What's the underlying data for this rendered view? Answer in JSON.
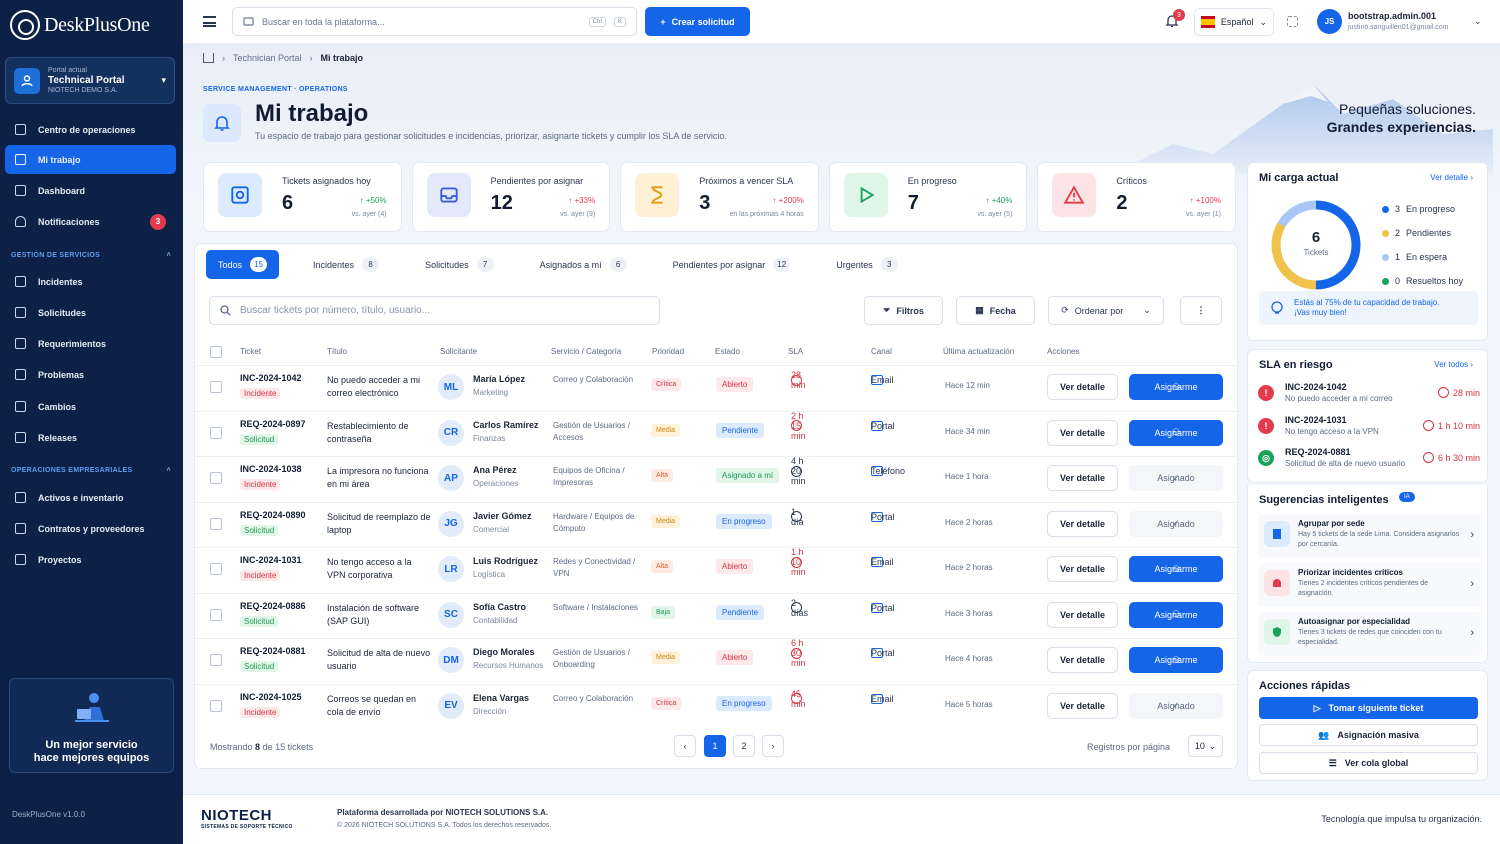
{
  "app": {
    "logo_text": "DeskPlusOne",
    "version": "DeskPlusOne v1.0.0"
  },
  "portal": {
    "caption": "Portal actual",
    "name": "Technical Portal",
    "org": "NIOTECH DEMO S.A."
  },
  "nav": {
    "main": [
      {
        "label": "Centro de operaciones"
      },
      {
        "label": "Mi trabajo",
        "active": true
      },
      {
        "label": "Dashboard"
      },
      {
        "label": "Notificaciones",
        "badge": "3"
      }
    ],
    "section_services": "GESTIÓN DE SERVICIOS",
    "services": [
      {
        "label": "Incidentes"
      },
      {
        "label": "Solicitudes"
      },
      {
        "label": "Requerimientos"
      },
      {
        "label": "Problemas"
      },
      {
        "label": "Cambios"
      },
      {
        "label": "Releases"
      }
    ],
    "section_ops": "OPERACIONES EMPRESARIALES",
    "ops": [
      {
        "label": "Activos e inventario"
      },
      {
        "label": "Contratos y proveedores"
      },
      {
        "label": "Proyectos"
      }
    ]
  },
  "promo": {
    "line1": "Un mejor servicio",
    "line2": "hace mejores equipos"
  },
  "topbar": {
    "search_placeholder": "Buscar en toda la plataforma...",
    "kbd1": "Ctrl",
    "kbd2": "K",
    "create_label": "Crear solicitud",
    "notif_count": "3",
    "language": "Español",
    "avatar_initials": "JS",
    "user_name": "bootstrap.admin.001",
    "user_email": "justino.sanguillen01@gmail.com"
  },
  "breadcrumb": {
    "parent": "Technician Portal",
    "current": "Mi trabajo"
  },
  "page": {
    "eyebrow": "SERVICE MANAGEMENT · OPERATIONS",
    "title": "Mi trabajo",
    "subtitle": "Tu espacio de trabajo para gestionar solicitudes e incidencias, priorizar, asignarte tickets y cumplir los SLA de servicio.",
    "slogan1": "Pequeñas soluciones.",
    "slogan2": "Grandes experiencias."
  },
  "kpis": [
    {
      "label": "Tickets asignados hoy",
      "value": "6",
      "delta": "+50%",
      "note": "vs. ayer (4)",
      "trend": "up",
      "color": "#1565e8",
      "bg": "#dceafd",
      "icon": "ticket-icon"
    },
    {
      "label": "Pendientes por asignar",
      "value": "12",
      "delta": "+33%",
      "note": "vs. ayer (9)",
      "trend": "down",
      "color": "#3a5bd9",
      "bg": "#e4e8fb",
      "icon": "inbox-icon"
    },
    {
      "label": "Próximos a vencer SLA",
      "value": "3",
      "delta": "+200%",
      "note": "en las próximas 4 horas",
      "trend": "down",
      "color": "#e29a12",
      "bg": "#fff0d6",
      "icon": "hourglass-icon"
    },
    {
      "label": "En progreso",
      "value": "7",
      "delta": "+40%",
      "note": "vs. ayer (5)",
      "trend": "up",
      "color": "#1aa35a",
      "bg": "#dff5e8",
      "icon": "play-icon"
    },
    {
      "label": "Críticos",
      "value": "2",
      "delta": "+100%",
      "note": "vs. ayer (1)",
      "trend": "down",
      "color": "#e33b4b",
      "bg": "#fde3e6",
      "icon": "warning-icon"
    }
  ],
  "tabs": [
    {
      "label": "Todos",
      "count": "15",
      "active": true
    },
    {
      "label": "Incidentes",
      "count": "8"
    },
    {
      "label": "Solicitudes",
      "count": "7"
    },
    {
      "label": "Asignados a mí",
      "count": "6"
    },
    {
      "label": "Pendientes por asignar",
      "count": "12"
    },
    {
      "label": "Urgentes",
      "count": "3"
    }
  ],
  "table": {
    "search_placeholder": "Buscar tickets por número, título, usuario...",
    "filters_label": "Filtros",
    "date_label": "Fecha",
    "sort_label": "Ordenar por",
    "headers": [
      "Ticket",
      "Título",
      "Solicitante",
      "Servicio / Categoría",
      "Prioridad",
      "Estado",
      "SLA",
      "Canal",
      "Última actualización",
      "Acciones"
    ],
    "view_label": "Ver detalle",
    "rows": [
      {
        "id": "INC-2024-1042",
        "type": "Incidente",
        "kind": "inc",
        "title": "No puedo acceder a mi correo electrónico",
        "initials": "ML",
        "name": "María López",
        "dept": "Marketing",
        "service": "Correo y Colaboración",
        "priority": "Crítica",
        "pclass": "critica",
        "status": "Abierto",
        "sclass": "abierto",
        "sla": "28 min",
        "slaclass": "red",
        "channel": "Email",
        "updated": "Hace 12 min",
        "action": "Asignarme",
        "aclass": "primary"
      },
      {
        "id": "REQ-2024-0897",
        "type": "Solicitud",
        "kind": "sol",
        "title": "Restablecimiento de contraseña",
        "initials": "CR",
        "name": "Carlos Ramírez",
        "dept": "Finanzas",
        "service": "Gestión de Usuarios / Accesos",
        "priority": "Media",
        "pclass": "media",
        "status": "Pendiente",
        "sclass": "pendiente",
        "sla": "2 h 15 min",
        "slaclass": "red",
        "channel": "Portal",
        "updated": "Hace 34 min",
        "action": "Asignarme",
        "aclass": "primary"
      },
      {
        "id": "INC-2024-1038",
        "type": "Incidente",
        "kind": "inc",
        "title": "La impresora no funciona en mi área",
        "initials": "AP",
        "name": "Ana Pérez",
        "dept": "Operaciones",
        "service": "Equipos de Oficina / Impresoras",
        "priority": "Alta",
        "pclass": "alta",
        "status": "Asignado a mí",
        "sclass": "asignado",
        "sla": "4 h 20 min",
        "slaclass": "dark",
        "channel": "Teléfono",
        "updated": "Hace 1 hora",
        "action": "Asignado",
        "aclass": "ghost"
      },
      {
        "id": "REQ-2024-0890",
        "type": "Solicitud",
        "kind": "sol",
        "title": "Solicitud de reemplazo de laptop",
        "initials": "JG",
        "name": "Javier Gómez",
        "dept": "Comercial",
        "service": "Hardware / Equipos de Cómputo",
        "priority": "Media",
        "pclass": "media",
        "status": "En progreso",
        "sclass": "progreso",
        "sla": "1 día",
        "slaclass": "dark",
        "channel": "Portal",
        "updated": "Hace 2 horas",
        "action": "Asignado",
        "aclass": "ghost"
      },
      {
        "id": "INC-2024-1031",
        "type": "Incidente",
        "kind": "inc",
        "title": "No tengo acceso a la VPN corporativa",
        "initials": "LR",
        "name": "Luis Rodríguez",
        "dept": "Logística",
        "service": "Redes y Conectividad / VPN",
        "priority": "Alta",
        "pclass": "alta",
        "status": "Abierto",
        "sclass": "abierto",
        "sla": "1 h 10 min",
        "slaclass": "red",
        "channel": "Email",
        "updated": "Hace 2 horas",
        "action": "Asignarme",
        "aclass": "primary"
      },
      {
        "id": "REQ-2024-0886",
        "type": "Solicitud",
        "kind": "sol",
        "title": "Instalación de software (SAP GUI)",
        "initials": "SC",
        "name": "Sofía Castro",
        "dept": "Contabilidad",
        "service": "Software / Instalaciones",
        "priority": "Baja",
        "pclass": "baja",
        "status": "Pendiente",
        "sclass": "pendiente",
        "sla": "2 días",
        "slaclass": "dark",
        "channel": "Portal",
        "updated": "Hace 3 horas",
        "action": "Asignarme",
        "aclass": "primary"
      },
      {
        "id": "REQ-2024-0881",
        "type": "Solicitud",
        "kind": "sol",
        "title": "Solicitud de alta de nuevo usuario",
        "initials": "DM",
        "name": "Diego Morales",
        "dept": "Recursos Humanos",
        "service": "Gestión de Usuarios / Onboarding",
        "priority": "Media",
        "pclass": "media",
        "status": "Abierto",
        "sclass": "abierto",
        "sla": "6 h 30 min",
        "slaclass": "red",
        "channel": "Portal",
        "updated": "Hace 4 horas",
        "action": "Asignarme",
        "aclass": "primary"
      },
      {
        "id": "INC-2024-1025",
        "type": "Incidente",
        "kind": "inc",
        "title": "Correos se quedan en cola de envío",
        "initials": "EV",
        "name": "Elena Vargas",
        "dept": "Dirección",
        "service": "Correo y Colaboración",
        "priority": "Crítica",
        "pclass": "critica",
        "status": "En progreso",
        "sclass": "progreso",
        "sla": "45 min",
        "slaclass": "red",
        "channel": "Email",
        "updated": "Hace 5 horas",
        "action": "Asignado",
        "aclass": "ghost"
      }
    ],
    "showing_prefix": "Mostrando",
    "showing_count": "8",
    "showing_suffix": "de 15 tickets",
    "pages": [
      "1",
      "2"
    ],
    "per_page_label": "Registros por página",
    "per_page": "10"
  },
  "workload": {
    "title": "Mi carga actual",
    "link": "Ver detalle",
    "total": "6",
    "total_label": "Tickets",
    "legend": [
      {
        "count": "3",
        "label": "En progreso",
        "color": "#1565e8"
      },
      {
        "count": "2",
        "label": "Pendientes",
        "color": "#f0c24b"
      },
      {
        "count": "1",
        "label": "En espera",
        "color": "#a9c6f6"
      },
      {
        "count": "0",
        "label": "Resueltos hoy",
        "color": "#1aa35a"
      }
    ],
    "capacity_line1": "Estás al 75% de tu capacidad de trabajo.",
    "capacity_line2": "¡Vas muy bien!"
  },
  "sla_risk": {
    "title": "SLA en riesgo",
    "link": "Ver todos",
    "items": [
      {
        "id": "INC-2024-1042",
        "desc": "No puedo acceder a mi correo",
        "time": "28 min",
        "color": "#e33b4b"
      },
      {
        "id": "INC-2024-1031",
        "desc": "No tengo acceso a la VPN",
        "time": "1 h 10 min",
        "color": "#e33b4b"
      },
      {
        "id": "REQ-2024-0881",
        "desc": "Solicitud de alta de nuevo usuario",
        "time": "6 h 30 min",
        "color": "#1aa35a"
      }
    ]
  },
  "suggestions": {
    "title": "Sugerencias inteligentes",
    "badge": "IA",
    "items": [
      {
        "title": "Agrupar por sede",
        "desc": "Hay 5 tickets de la sede Lima. Considera asignarlos por cercanía.",
        "color": "#1565e8",
        "bg": "#dceafd"
      },
      {
        "title": "Priorizar incidentes críticos",
        "desc": "Tienes 2 incidentes críticos pendientes de asignación.",
        "color": "#e33b4b",
        "bg": "#fde3e6"
      },
      {
        "title": "Autoasignar por especialidad",
        "desc": "Tienes 3 tickets de redes que coinciden con tu especialidad.",
        "color": "#1aa35a",
        "bg": "#dff5e8"
      }
    ]
  },
  "quick": {
    "title": "Acciones rápidas",
    "next": "Tomar siguiente ticket",
    "mass": "Asignación masiva",
    "queue": "Ver cola global"
  },
  "footer": {
    "brand": "NIOTECH",
    "brand_sub": "SISTEMAS DE SOPORTE TÉCNICO",
    "line1": "Plataforma desarrollada por NIOTECH SOLUTIONS S.A.",
    "line2": "© 2026 NIOTECH SOLUTIONS S.A. Todos los derechos reservados.",
    "tagline": "Tecnología que impulsa tu organización."
  }
}
